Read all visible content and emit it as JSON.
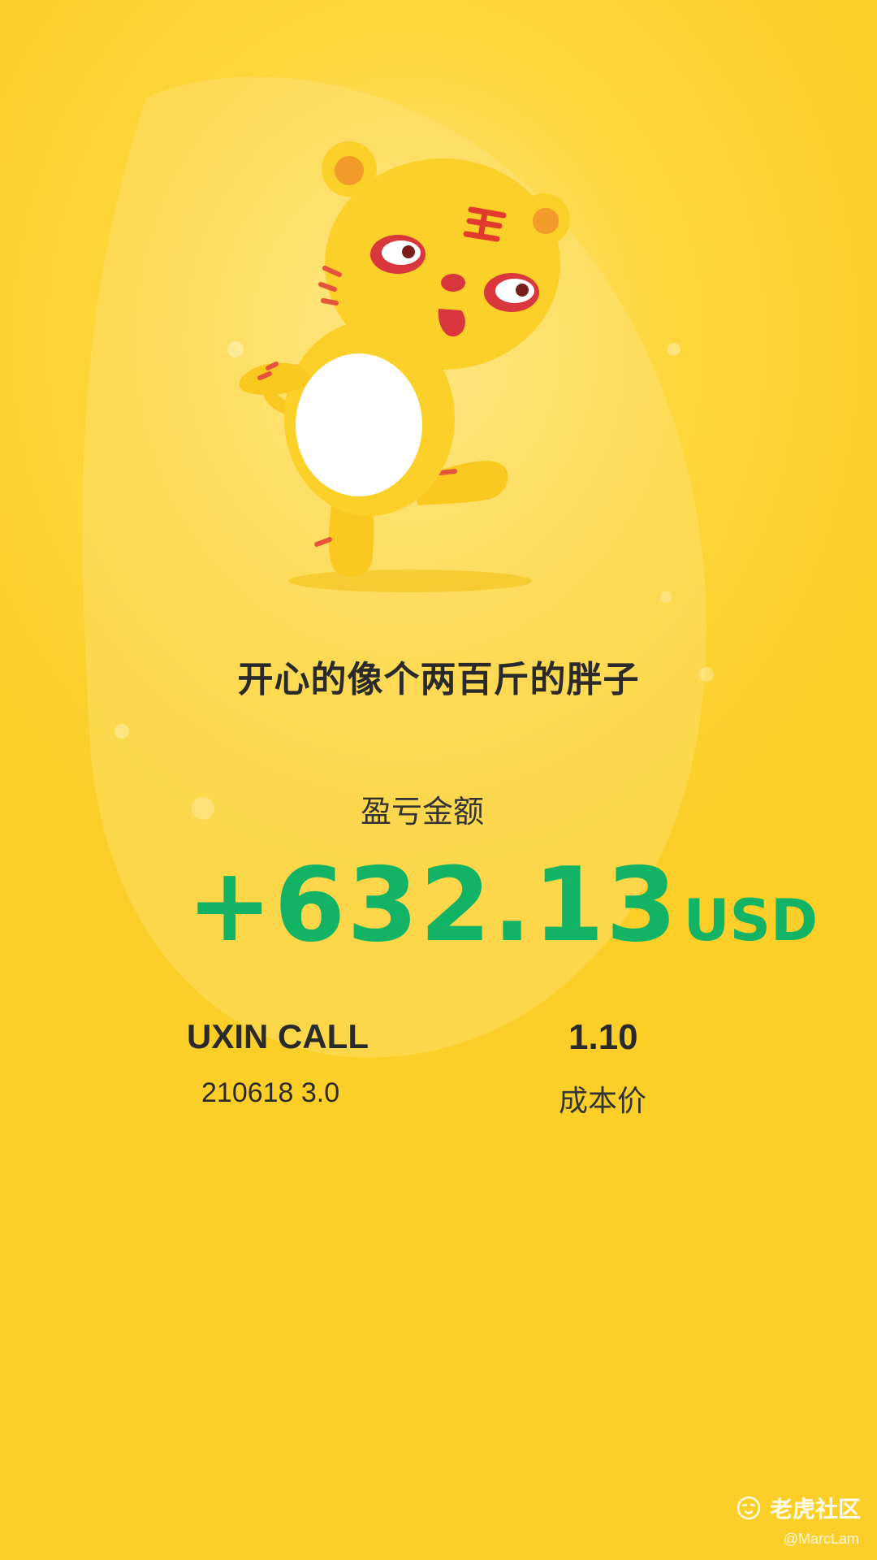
{
  "mascot": {
    "icon": "tiger-mascot"
  },
  "caption": "开心的像个两百斤的胖子",
  "pnl": {
    "label": "盈亏金额",
    "value": "+632.13",
    "currency": "USD",
    "color": "#12b364"
  },
  "contract": {
    "name": "UXIN CALL",
    "detail": "210618 3.0"
  },
  "cost": {
    "value": "1.10",
    "label": "成本价"
  },
  "watermark": {
    "brand": "老虎社区",
    "user": "@MarcLam",
    "icon": "tiger-logo-icon"
  },
  "colors": {
    "background": "#fdd63a",
    "profit_green": "#12b364"
  }
}
